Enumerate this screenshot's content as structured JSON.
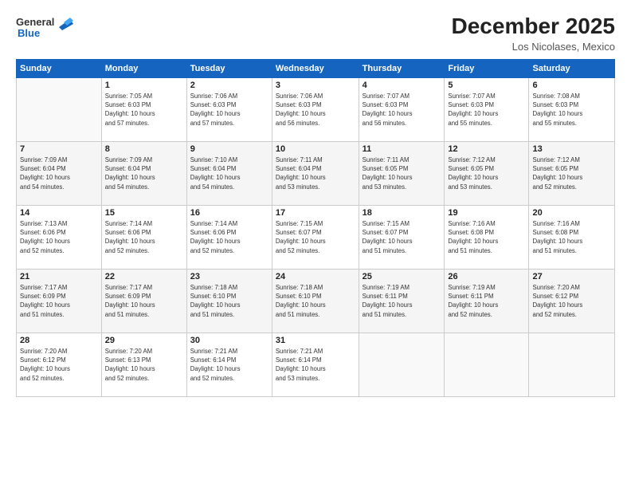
{
  "header": {
    "logo": {
      "line1": "General",
      "line2": "Blue"
    },
    "title": "December 2025",
    "location": "Los Nicolases, Mexico"
  },
  "days_of_week": [
    "Sunday",
    "Monday",
    "Tuesday",
    "Wednesday",
    "Thursday",
    "Friday",
    "Saturday"
  ],
  "weeks": [
    [
      {
        "day": "",
        "info": ""
      },
      {
        "day": "1",
        "info": "Sunrise: 7:05 AM\nSunset: 6:03 PM\nDaylight: 10 hours\nand 57 minutes."
      },
      {
        "day": "2",
        "info": "Sunrise: 7:06 AM\nSunset: 6:03 PM\nDaylight: 10 hours\nand 57 minutes."
      },
      {
        "day": "3",
        "info": "Sunrise: 7:06 AM\nSunset: 6:03 PM\nDaylight: 10 hours\nand 56 minutes."
      },
      {
        "day": "4",
        "info": "Sunrise: 7:07 AM\nSunset: 6:03 PM\nDaylight: 10 hours\nand 56 minutes."
      },
      {
        "day": "5",
        "info": "Sunrise: 7:07 AM\nSunset: 6:03 PM\nDaylight: 10 hours\nand 55 minutes."
      },
      {
        "day": "6",
        "info": "Sunrise: 7:08 AM\nSunset: 6:03 PM\nDaylight: 10 hours\nand 55 minutes."
      }
    ],
    [
      {
        "day": "7",
        "info": "Sunrise: 7:09 AM\nSunset: 6:04 PM\nDaylight: 10 hours\nand 54 minutes."
      },
      {
        "day": "8",
        "info": "Sunrise: 7:09 AM\nSunset: 6:04 PM\nDaylight: 10 hours\nand 54 minutes."
      },
      {
        "day": "9",
        "info": "Sunrise: 7:10 AM\nSunset: 6:04 PM\nDaylight: 10 hours\nand 54 minutes."
      },
      {
        "day": "10",
        "info": "Sunrise: 7:11 AM\nSunset: 6:04 PM\nDaylight: 10 hours\nand 53 minutes."
      },
      {
        "day": "11",
        "info": "Sunrise: 7:11 AM\nSunset: 6:05 PM\nDaylight: 10 hours\nand 53 minutes."
      },
      {
        "day": "12",
        "info": "Sunrise: 7:12 AM\nSunset: 6:05 PM\nDaylight: 10 hours\nand 53 minutes."
      },
      {
        "day": "13",
        "info": "Sunrise: 7:12 AM\nSunset: 6:05 PM\nDaylight: 10 hours\nand 52 minutes."
      }
    ],
    [
      {
        "day": "14",
        "info": "Sunrise: 7:13 AM\nSunset: 6:06 PM\nDaylight: 10 hours\nand 52 minutes."
      },
      {
        "day": "15",
        "info": "Sunrise: 7:14 AM\nSunset: 6:06 PM\nDaylight: 10 hours\nand 52 minutes."
      },
      {
        "day": "16",
        "info": "Sunrise: 7:14 AM\nSunset: 6:06 PM\nDaylight: 10 hours\nand 52 minutes."
      },
      {
        "day": "17",
        "info": "Sunrise: 7:15 AM\nSunset: 6:07 PM\nDaylight: 10 hours\nand 52 minutes."
      },
      {
        "day": "18",
        "info": "Sunrise: 7:15 AM\nSunset: 6:07 PM\nDaylight: 10 hours\nand 51 minutes."
      },
      {
        "day": "19",
        "info": "Sunrise: 7:16 AM\nSunset: 6:08 PM\nDaylight: 10 hours\nand 51 minutes."
      },
      {
        "day": "20",
        "info": "Sunrise: 7:16 AM\nSunset: 6:08 PM\nDaylight: 10 hours\nand 51 minutes."
      }
    ],
    [
      {
        "day": "21",
        "info": "Sunrise: 7:17 AM\nSunset: 6:09 PM\nDaylight: 10 hours\nand 51 minutes."
      },
      {
        "day": "22",
        "info": "Sunrise: 7:17 AM\nSunset: 6:09 PM\nDaylight: 10 hours\nand 51 minutes."
      },
      {
        "day": "23",
        "info": "Sunrise: 7:18 AM\nSunset: 6:10 PM\nDaylight: 10 hours\nand 51 minutes."
      },
      {
        "day": "24",
        "info": "Sunrise: 7:18 AM\nSunset: 6:10 PM\nDaylight: 10 hours\nand 51 minutes."
      },
      {
        "day": "25",
        "info": "Sunrise: 7:19 AM\nSunset: 6:11 PM\nDaylight: 10 hours\nand 51 minutes."
      },
      {
        "day": "26",
        "info": "Sunrise: 7:19 AM\nSunset: 6:11 PM\nDaylight: 10 hours\nand 52 minutes."
      },
      {
        "day": "27",
        "info": "Sunrise: 7:20 AM\nSunset: 6:12 PM\nDaylight: 10 hours\nand 52 minutes."
      }
    ],
    [
      {
        "day": "28",
        "info": "Sunrise: 7:20 AM\nSunset: 6:12 PM\nDaylight: 10 hours\nand 52 minutes."
      },
      {
        "day": "29",
        "info": "Sunrise: 7:20 AM\nSunset: 6:13 PM\nDaylight: 10 hours\nand 52 minutes."
      },
      {
        "day": "30",
        "info": "Sunrise: 7:21 AM\nSunset: 6:14 PM\nDaylight: 10 hours\nand 52 minutes."
      },
      {
        "day": "31",
        "info": "Sunrise: 7:21 AM\nSunset: 6:14 PM\nDaylight: 10 hours\nand 53 minutes."
      },
      {
        "day": "",
        "info": ""
      },
      {
        "day": "",
        "info": ""
      },
      {
        "day": "",
        "info": ""
      }
    ]
  ]
}
